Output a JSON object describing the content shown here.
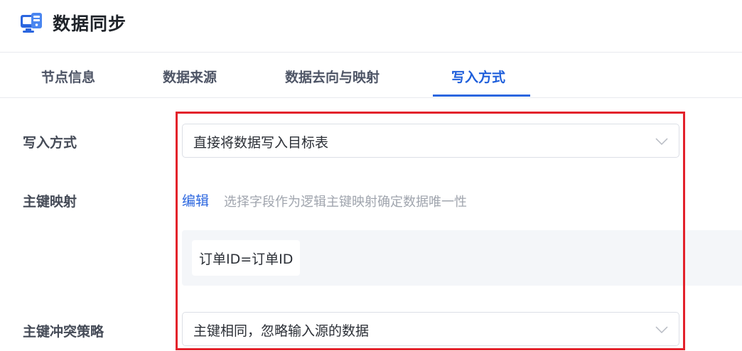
{
  "header": {
    "title": "数据同步",
    "icon": "data-sync-icon"
  },
  "tabs": [
    {
      "label": "节点信息",
      "active": false
    },
    {
      "label": "数据来源",
      "active": false
    },
    {
      "label": "数据去向与映射",
      "active": false
    },
    {
      "label": "写入方式",
      "active": true
    }
  ],
  "form": {
    "write_mode": {
      "label": "写入方式",
      "value": "直接将数据写入目标表"
    },
    "primary_key_mapping": {
      "label": "主键映射",
      "edit_label": "编辑",
      "hint": "选择字段作为逻辑主键映射确定数据唯一性",
      "mappings": [
        "订单ID=订单ID"
      ]
    },
    "conflict_strategy": {
      "label": "主键冲突策略",
      "value": "主键相同，忽略输入源的数据"
    }
  },
  "colors": {
    "accent": "#2b66df",
    "highlight": "#e3212b",
    "panel_bg": "#f4f6f9"
  }
}
